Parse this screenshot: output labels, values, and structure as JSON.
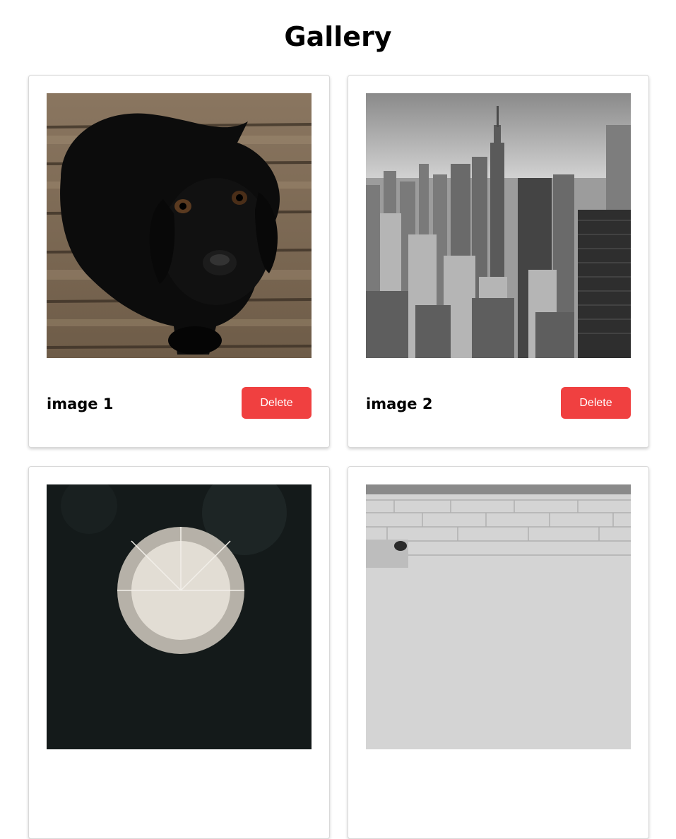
{
  "page": {
    "title": "Gallery"
  },
  "colors": {
    "delete_button": "#f04040",
    "card_border": "#d9d9d9"
  },
  "gallery": {
    "items": [
      {
        "caption": "image 1",
        "delete_label": "Delete",
        "image_subject": "black-puppy-on-wooden-floor"
      },
      {
        "caption": "image 2",
        "delete_label": "Delete",
        "image_subject": "black-and-white-city-skyline"
      },
      {
        "caption": "",
        "delete_label": "",
        "image_subject": "dandelion-seed-head"
      },
      {
        "caption": "",
        "delete_label": "",
        "image_subject": "stone-wall-with-steps"
      }
    ]
  }
}
